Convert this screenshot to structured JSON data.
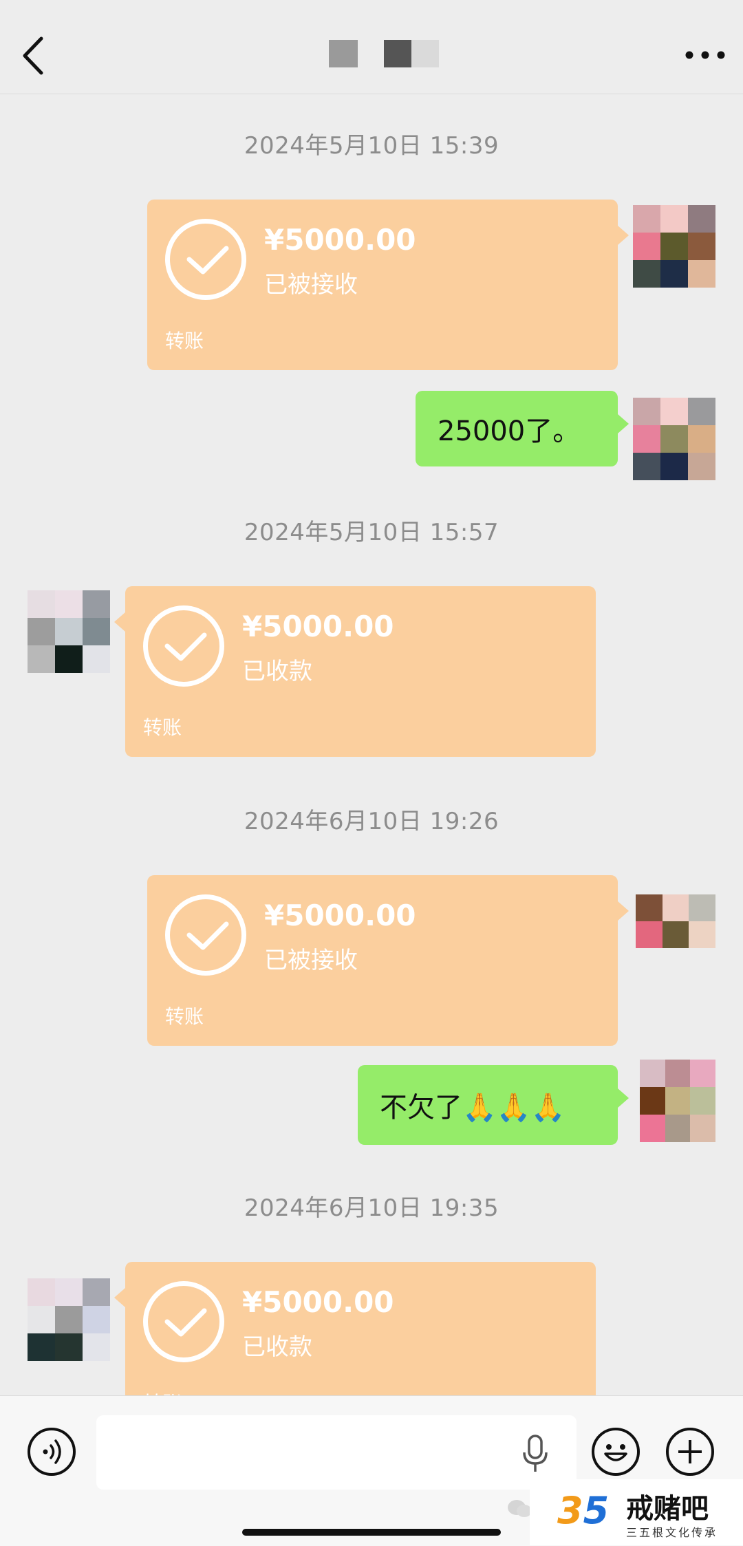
{
  "header": {
    "back_icon": "chevron-left-icon",
    "more_icon": "more-dots-icon",
    "title_blocks": [
      "#9a9a9a",
      "#555555",
      "#dadada"
    ]
  },
  "messages": [
    {
      "kind": "time",
      "text": "2024年5月10日 15:39"
    },
    {
      "kind": "transfer",
      "side": "right",
      "amount": "¥5000.00",
      "status": "已被接收",
      "label": "转账",
      "avatar": [
        "#d9a7ab",
        "#f3c9c6",
        "#8f7b80",
        "#e9798f",
        "#5c5a2c",
        "#8b5a3d",
        "#3f4b45",
        "#1e2d47",
        "#e0b79a"
      ]
    },
    {
      "kind": "text",
      "side": "right",
      "text": "25000了。",
      "avatar": [
        "#c9a6a8",
        "#f4cfcd",
        "#9a9a9c",
        "#e7819c",
        "#8d8a5e",
        "#d9ae86",
        "#454f5b",
        "#1c2948",
        "#c7a796"
      ]
    },
    {
      "kind": "time",
      "text": "2024年5月10日 15:57"
    },
    {
      "kind": "transfer",
      "side": "left",
      "amount": "¥5000.00",
      "status": "已收款",
      "label": "转账",
      "avatar": [
        "#e6dde2",
        "#ecdfe6",
        "#979ba2",
        "#9d9d9d",
        "#c6cdd2",
        "#7f8b91",
        "#b8b8b8",
        "#101e1a",
        "#e2e3e8"
      ]
    },
    {
      "kind": "time",
      "text": "2024年6月10日 19:26"
    },
    {
      "kind": "transfer",
      "side": "right",
      "amount": "¥5000.00",
      "status": "已被接收",
      "label": "转账",
      "avatar": [
        "#7d5038",
        "#efcfc5",
        "#bdbcb4",
        "#e3677e",
        "#6a5b37",
        "#edd3c3"
      ]
    },
    {
      "kind": "text",
      "side": "right",
      "text": "不欠了🙏🙏🙏",
      "avatar": [
        "#d8bcc4",
        "#bc8d93",
        "#e8a9bf",
        "#6b3816",
        "#c3b283",
        "#bbbf9a",
        "#ec7495",
        "#a8998a",
        "#dbbcaa"
      ]
    },
    {
      "kind": "time",
      "text": "2024年6月10日 19:35"
    },
    {
      "kind": "transfer",
      "side": "left",
      "amount": "¥5000.00",
      "status": "已收款",
      "label": "转账",
      "avatar": [
        "#e8d9e0",
        "#e8dfe8",
        "#a7a8b1",
        "#e6e6e8",
        "#9b9b9b",
        "#cfd3e4",
        "#1e3233",
        "#253530",
        "#e3e4ea"
      ]
    }
  ],
  "composer": {
    "voice_icon": "voice-icon",
    "mic_icon": "microphone-icon",
    "emoji_icon": "emoji-icon",
    "plus_icon": "plus-icon",
    "input_value": ""
  },
  "watermark": {
    "logo_a": "3",
    "logo_b": "5",
    "title": "戒赌吧",
    "subtitle": "三五根文化传承"
  },
  "colors": {
    "background": "#ededed",
    "transfer_bubble": "#fbcf9e",
    "text_bubble": "#95ec69",
    "time_text": "#8c8c8c"
  }
}
